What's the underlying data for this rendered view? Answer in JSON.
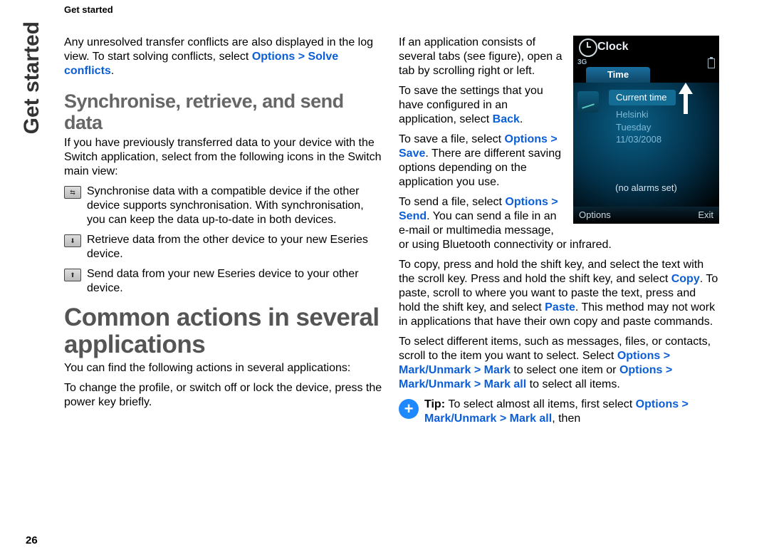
{
  "running_head": "Get started",
  "side_tab": "Get started",
  "page_number": "26",
  "left": {
    "intro_a": "Any unresolved transfer conflicts are also displayed in the log view. To start solving conflicts, select ",
    "intro_b": "Options > Solve conflicts",
    "intro_c": ".",
    "sync_heading": "Synchronise, retrieve, and send data",
    "sync_intro": "If you have previously transferred data to your device with the Switch application, select from the following icons in the Switch main view:",
    "icon1": "Synchronise data with a compatible device if the other device supports synchronisation. With synchronisation, you can keep the data up-to-date in both devices.",
    "icon2": "Retrieve data from the other device to your new Eseries device.",
    "icon3": "Send data from your new Eseries device to your other device.",
    "common_heading": "Common actions in several applications",
    "common_p1": "You can find the following actions in several applications:",
    "common_p2": "To change the profile, or switch off or lock the device, press the power key briefly."
  },
  "right": {
    "tabs_a": "If an application consists of several tabs (see figure), open a tab by scrolling right or left.",
    "save1_a": "To save the settings that you have configured in an application, select ",
    "save1_b": "Back",
    "save1_c": ".",
    "save2_a": "To save a file, select ",
    "save2_b": "Options > Save",
    "save2_c": ". There are different saving options depending on the application you use.",
    "send_a": "To send a file, select ",
    "send_b": "Options > Send",
    "send_c": ". You can send a file in an e-mail or multimedia message, or using Bluetooth connectivity or infrared.",
    "copy_a": "To copy, press and hold the shift key, and select the text with the scroll key. Press and hold the shift key, and select ",
    "copy_b": "Copy",
    "copy_c": ". To paste, scroll to where you want to paste the text, press and hold the shift key, and select ",
    "copy_d": "Paste",
    "copy_e": ". This method may not work in applications that have their own copy and paste commands.",
    "sel_a": "To select different items, such as messages, files, or contacts, scroll to the item you want to select. Select ",
    "sel_b": "Options > Mark/Unmark > Mark",
    "sel_c": " to select one item or ",
    "sel_d": "Options > Mark/Unmark > Mark all",
    "sel_e": " to select all items.",
    "tip_label": "Tip: ",
    "tip_a": "To select almost all items, first select ",
    "tip_b": "Options > Mark/Unmark > Mark all",
    "tip_c": ", then"
  },
  "phone": {
    "title": "Clock",
    "net": "3G",
    "tab": "Time",
    "current": "Current time",
    "city": "Helsinki",
    "day": "Tuesday",
    "date": "11/03/2008",
    "noalarm": "(no alarms set)",
    "soft_left": "Options",
    "soft_right": "Exit"
  }
}
